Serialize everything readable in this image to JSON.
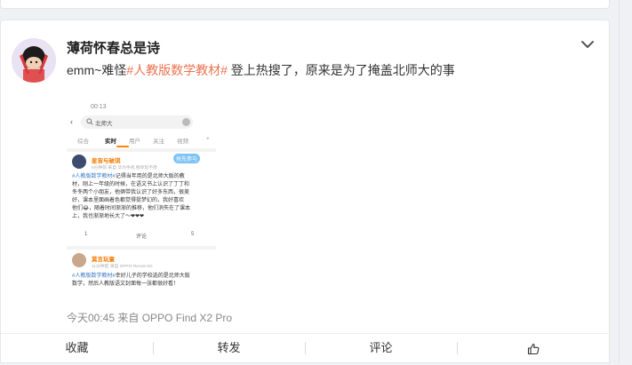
{
  "post": {
    "username": "薄荷怀春总是诗",
    "text_prefix": "emm~难怪",
    "text_tag": "#人教版数学教材#",
    "text_suffix": " 登上热搜了，原来是为了掩盖北师大的事",
    "meta": "今天00:45  来自 OPPO Find X2 Pro"
  },
  "screenshot": {
    "time": "00:13",
    "search_query": "北师大",
    "tabs": [
      "综合",
      "实时",
      "用户",
      "关注",
      "视频"
    ],
    "post1": {
      "name": "星宙与破琪",
      "meta": "8分钟前 来自 华为手机 畅享玩不停",
      "badge": "抢先参与",
      "body_tag": "#人教版数学教材#",
      "body_lines": [
        "记得当年用的是北师大版的教",
        "材，刚上一年级的时候，在语文书上认识了丁丁和",
        "冬冬两个小朋友，他俩带我认识了好多东西，很美",
        "好，课本里面画着色都觉得挺梦幻的，我好喜欢",
        "他们😂，随着时间渐渐的推移，他们消失在了课本",
        "上，我也渐渐地长大了～❤❤❤"
      ],
      "actions": [
        "1",
        "评论",
        "5"
      ]
    },
    "post2": {
      "name": "莫言玩童",
      "meta": "11分钟前 来自 OPPO Reno6 5G",
      "body_tag": "#人教版数学教材#",
      "body_lines": [
        "幸好儿子的学校选的是北师大版",
        "数学，然后人教版语文封面每一张都很好看！"
      ]
    }
  },
  "actions": {
    "favorite": "收藏",
    "repost": "转发",
    "comment": "评论"
  },
  "colors": {
    "accent": "#eb7350",
    "name_orange": "#f77b00",
    "tag_blue": "#3a78c3"
  }
}
